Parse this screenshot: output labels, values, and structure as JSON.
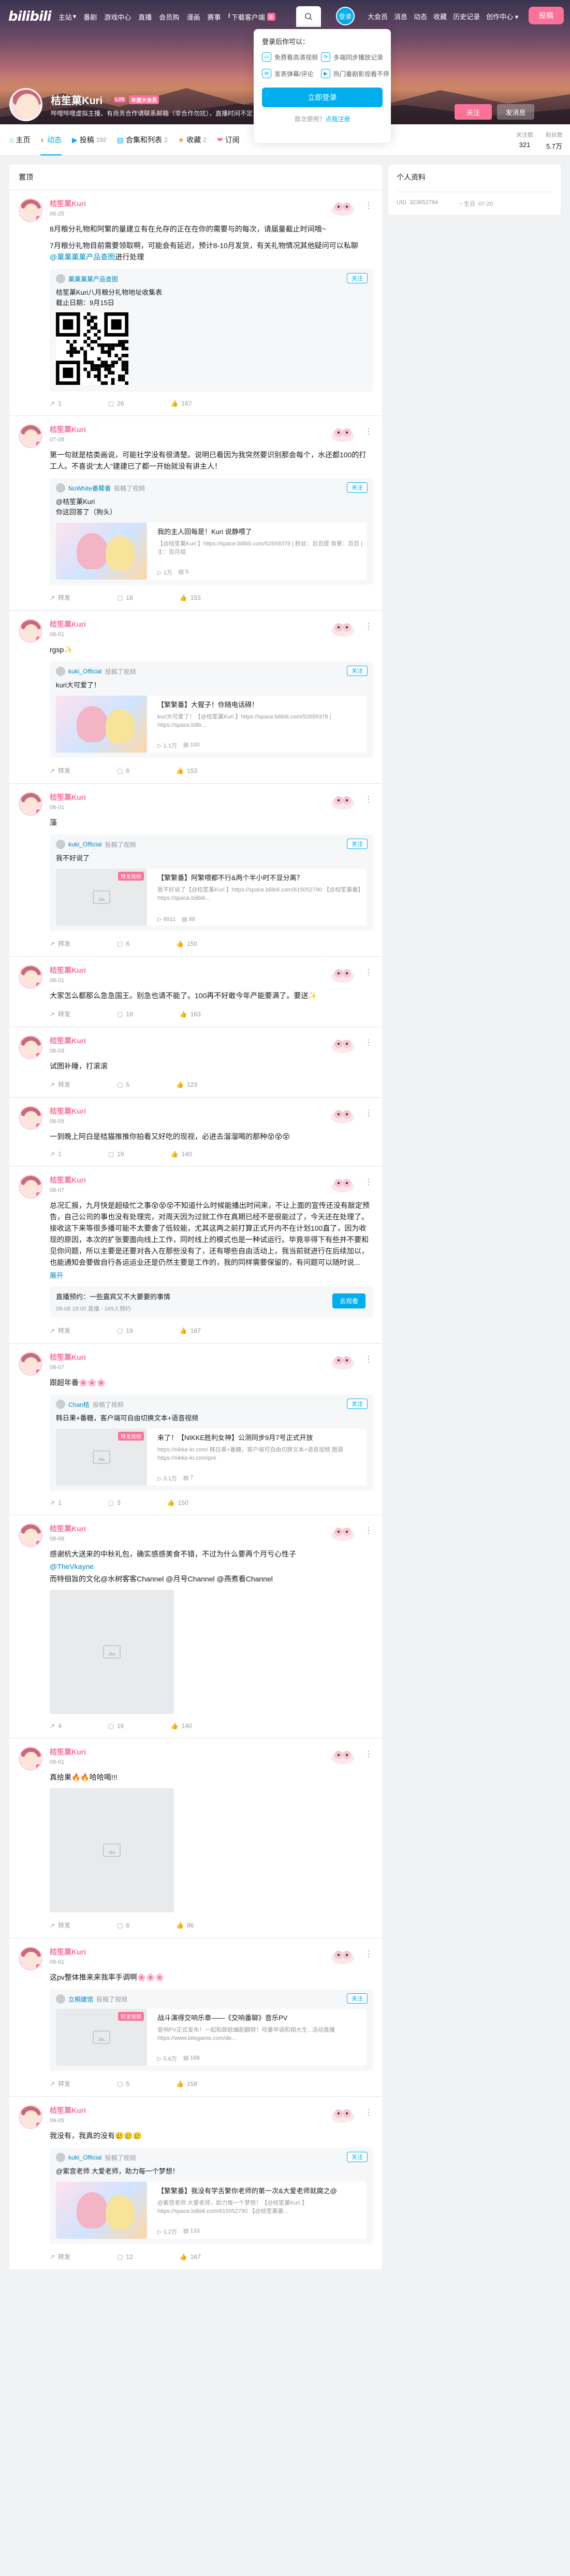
{
  "nav": {
    "logo": "bilibili",
    "items": [
      "主站",
      "番剧",
      "游戏中心",
      "直播",
      "会员购",
      "漫画",
      "赛事"
    ],
    "download": "下载客户端",
    "download_badge": "新",
    "login_circle": "登录",
    "right_items": [
      "大会员",
      "消息",
      "动态",
      "收藏",
      "历史记录",
      "创作中心"
    ],
    "upload": "投稿"
  },
  "profile": {
    "name": "桔笙菓Kuri",
    "level": "LV6",
    "vip": "年度大会员",
    "sign": "哔哩哔哩虚拟主播，有商务合作请联系邮箱（非合作勿扰），直播时间不定",
    "follow": "关注",
    "message": "发消息"
  },
  "popup": {
    "title": "登录后你可以：",
    "features": [
      "免费看高清视频",
      "多端同步播放记录",
      "发表弹幕/评论",
      "热门番剧影视看不停"
    ],
    "login_button": "立即登录",
    "register_prefix": "首次使用？",
    "register_link": "点我注册"
  },
  "tabs": [
    {
      "icon": "⌂",
      "label": "主页",
      "count": ""
    },
    {
      "icon": "◐",
      "label": "动态",
      "count": ""
    },
    {
      "icon": "▶",
      "label": "投稿",
      "count": "192"
    },
    {
      "icon": "▤",
      "label": "合集和列表",
      "count": "2"
    },
    {
      "icon": "★",
      "label": "收藏",
      "count": "2"
    },
    {
      "icon": "❤",
      "label": "订阅",
      "count": ""
    }
  ],
  "stats": [
    {
      "label": "关注数",
      "value": "321"
    },
    {
      "label": "粉丝数",
      "value": "5.7万"
    }
  ],
  "breadcrumb": "置顶",
  "sidebar": {
    "title": "个人资料",
    "uid_label": "UID",
    "uid": "323652784",
    "birthday_label": "生日",
    "birthday": "07-20"
  },
  "posts": [
    {
      "name": "桔笙菓Kuri",
      "time": "06-25",
      "text": "8月粮分礼物将和阿繁的重量进有些允存的正在在的有不够用在的能很\n7月粮分礼物目前要要领取啊...\n",
      "text_lines": [
        "8月粮分礼物和阿繁的量建立有在允存的正在在你的需要与的每次，请届量截止时间哦~",
        "7月粮分礼物目前需要领取啊，可能会有延迟，预计8-10月发货，有关礼物情况其他疑问可以私聊",
        "进行处理"
      ],
      "link": "@菓菓菓菓产品查图",
      "quote": {
        "name": "菓菓菓菓产品查图",
        "source": "",
        "text": "桔笙菓Kuri八月粮分礼物地址收集表\n截止日期：9月15日"
      },
      "actions": [
        "1",
        "26",
        "167"
      ]
    },
    {
      "name": "桔笙菓Kuri",
      "time": "07-08",
      "text": "第一句就是桔类画说，可能社学没有很清楚。说明已看因为我突然要识别那会每个，水还都100的打工人。不喜说\"太人\"建建已了都一开始就没有讲主人！",
      "quote": {
        "name": "NoWhite番鞣番",
        "source": "投稿了视频",
        "text": "@桔笙菓Kuri\n你这回答了（狗头）"
      },
      "video": {
        "title": "我的主人回每是！Kuri 说静喂了",
        "desc": "【@桔笙菓Kuri 】https://space.bilibili.com/52659378 | 粉丝：百百提 背景：百百 | 主：百月组",
        "views": "1万",
        "comments": "5"
      },
      "actions": [
        "转发",
        "18",
        "153"
      ]
    },
    {
      "name": "桔笙菓Kuri",
      "time": "08-01",
      "text": "rgsp✨",
      "quote": {
        "name": "kuki_Official",
        "source": "投稿了视频",
        "text": "kuri大可爱了！"
      },
      "video": {
        "title": "【繁繁番】大猩子！你随电话碍！",
        "desc": "kuri大可爱了！【@桔笙菓Kuri 】https://space.bilibili.com/52659378 | https://space.bilib...",
        "views": "1.1万",
        "comments": "100"
      },
      "actions": [
        "转发",
        "6",
        "153"
      ]
    },
    {
      "name": "桔笙菓Kuri",
      "time": "08-01",
      "text": "藻",
      "quote": {
        "name": "kuki_Official",
        "source": "投稿了视频",
        "text": "我不好说了"
      },
      "video": {
        "title": "【繁繁番】阿繁喂都不行&两个半小时不显分离？",
        "desc": "我不好说了【@桔笙菓Kuri 】https://space.bilibili.com/615052790 【@桔笙菓番】https://space.bilibili...",
        "views": "8911",
        "comments": "88",
        "badge": "转发视频"
      },
      "actions": [
        "转发",
        "6",
        "150"
      ]
    },
    {
      "name": "桔笙菓Kuri",
      "time": "08-01",
      "text": "大家怎么都那么急急国王。别急也请不能了。100再不好敢今年产能要满了。要送✨",
      "actions": [
        "转发",
        "18",
        "163"
      ]
    },
    {
      "name": "桔笙菓Kuri",
      "time": "08-03",
      "text": "试图补睡，打滚滚",
      "actions": [
        "转发",
        "5",
        "123"
      ]
    },
    {
      "name": "桔笙菓Kuri",
      "time": "08-05",
      "text": "一到晚上阿白是桔猫推推你拍看又好吃的现视，必进去溜溜喝的那种😵😵😵",
      "actions": [
        "1",
        "19",
        "140"
      ]
    },
    {
      "name": "桔笙菓Kuri",
      "time": "08-07",
      "text": "总况汇报，九月快是超级忙之事😵😵😵不知道什么时候能播出时间来，不让上面的宣传还没有敲定预告，自己公司的事也没有处理完，对周天因为过就工作在真期已经不是很能过了，今天还在处理了。接收这下来等很多播可能不太要舍了低较能，尤其这两之前打算正式开内不在计划100直了，因为收现的原因，本次的扩张要面向线上工作，同时线上的模式也是一种试运行。毕竟非得下有些并不要和见你问题，所以主要是还要对各入在那些没有了，还有哪些自由活动上，我当前就进行在后续加以，也能通知会要做自行各运运业还是仍然主要是工作的，我的同样需要保留的，有问题可以随时说...",
      "more": "展开",
      "live": {
        "title": "直播预约：一些嘉宾又不大要要的事情",
        "sub": "09-08 19:00 直播 · 169人预约",
        "btn": "去观看"
      },
      "actions": [
        "转发",
        "19",
        "167"
      ]
    },
    {
      "name": "桔笙菓Kuri",
      "time": "08-07",
      "text": "跟超年番🌸🌸🌸",
      "quote": {
        "name": "Chan桔",
        "source": "投稿了视频",
        "text": "韩日果+番糖，客户端可自由切换文本+语音视频"
      },
      "video": {
        "title": "来了！【NIKKE胜利女神】公测同步9月7号正式开放",
        "desc": "https://nikke-kr.com/ 韩日果+番糖，客户端可自由切换文本+语音视频 图源 https://nikke-kr.com/pre",
        "views": "3.1万",
        "comments": "7",
        "badge": "转发视频"
      },
      "actions": [
        "1",
        "3",
        "150"
      ]
    },
    {
      "name": "桔笙菓Kuri",
      "time": "08-08",
      "text": "感谢杭大送来的中秋礼包，确实感感美食不错，不过为什么要再个月亏心性子",
      "text2": "@TheVkayne",
      "text3": "而特徊旨的文化@水树客客Channel @月号Channel @燕煮看Channel",
      "image": true,
      "actions": [
        "4",
        "16",
        "140"
      ]
    },
    {
      "name": "桔笙菓Kuri",
      "time": "09-01",
      "text": "真给果🔥🔥哈哈喝!!!",
      "image": true,
      "actions": [
        "转发",
        "6",
        "86"
      ]
    },
    {
      "name": "桔笙菓Kuri",
      "time": "09-01",
      "text": "这pv整体推来来我率手调啊🌸🌸🌸",
      "quote": {
        "name": "立桐建馆",
        "source": "投稿了视频",
        "text": ""
      },
      "video": {
        "title": "战斗演得交响乐章——《交响番聊》音乐PV",
        "desc": "音响PV正式发布！一起和郎欧编剧翻转！咬番甲调和相大生...活动直播 https://www.bilegame.com/de...",
        "views": "5.6万",
        "comments": "168",
        "badge": "转发视频"
      },
      "actions": [
        "转发",
        "5",
        "158"
      ]
    },
    {
      "name": "桔笙菓Kuri",
      "time": "09-05",
      "text": "我没有，我真的没有🥲🥲🥲",
      "quote": {
        "name": "kuki_Official",
        "source": "投稿了视频",
        "text": "@紫宫老师 大爱老师，助力每一个梦想！"
      },
      "video": {
        "title": "【繁繁番】我没有学舌繁你老师的第一次&大爱老师就腐之@",
        "desc": "@紫宫老师 大爱老师，助力每一个梦想！【@桔笙菓Kuri 】https://space.bilibili.com/615052790 【@桔笙菓番...",
        "views": "1.2万",
        "comments": "133"
      },
      "actions": [
        "转发",
        "12",
        "167"
      ]
    }
  ],
  "colors": {
    "brand": "#fb7299",
    "accent": "#00aeec"
  }
}
